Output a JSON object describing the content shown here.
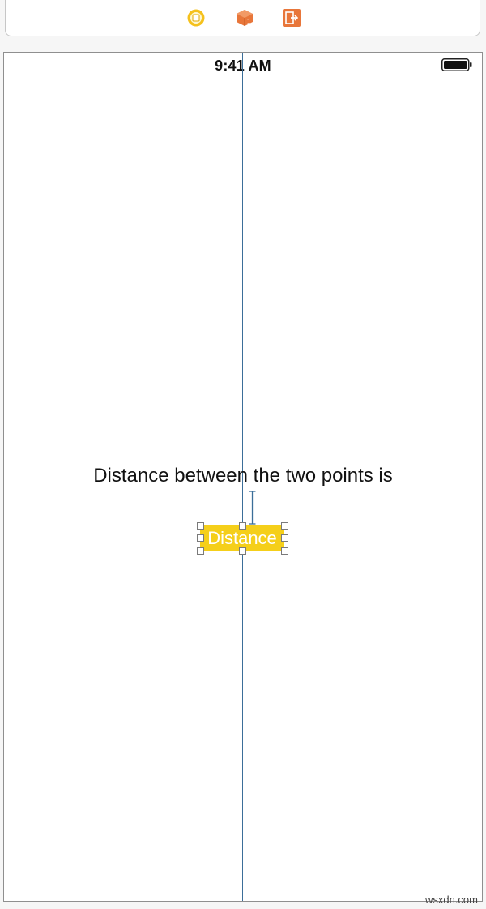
{
  "dock": {
    "icons": [
      {
        "name": "view-controller-icon",
        "color": "#f5c11c"
      },
      {
        "name": "first-responder-icon",
        "color": "#e8763a"
      },
      {
        "name": "exit-icon",
        "color": "#e8763a"
      }
    ]
  },
  "scene": {
    "status_time": "9:41 AM",
    "title_label": "Distance between the two points is",
    "distance_label": "Distance",
    "accent_color": "#3b6e99",
    "label_background": "#f5cf1a"
  },
  "watermark": "wsxdn.com"
}
